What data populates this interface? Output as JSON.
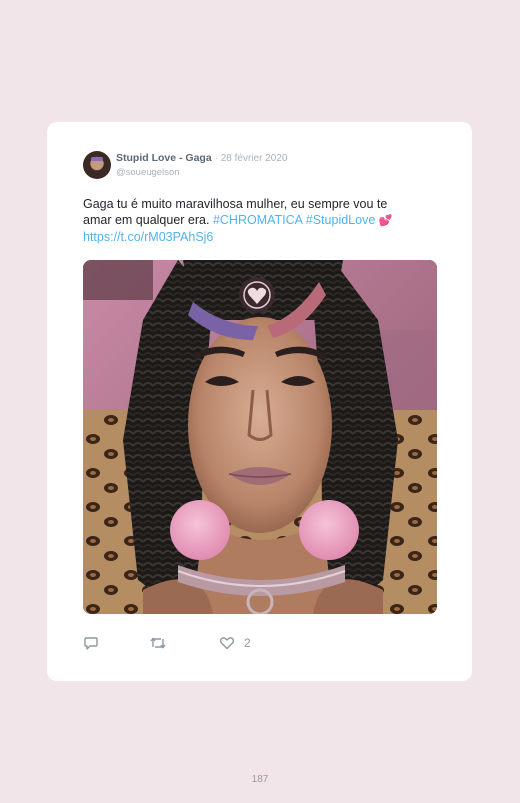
{
  "tweet": {
    "display_name": "Stupid Love - Gaga",
    "date": "· 28 février 2020",
    "handle": "@soueugelson",
    "text": "Gaga tu é muito maravilhosa mulher, eu sempre vou te amar em qualquer era.",
    "hashtags": "#CHROMATICA #StupidLove",
    "emoji": "💕",
    "link": "https://t.co/rM03PAhSj6",
    "like_count": "2",
    "icons": {
      "reply": "reply-icon",
      "retweet": "retweet-icon",
      "like": "heart-icon"
    }
  },
  "page_number": "187",
  "colors": {
    "background": "#f2e5e9",
    "card": "#ffffff",
    "link": "#4fb3ec",
    "icon": "#8b98a5"
  }
}
